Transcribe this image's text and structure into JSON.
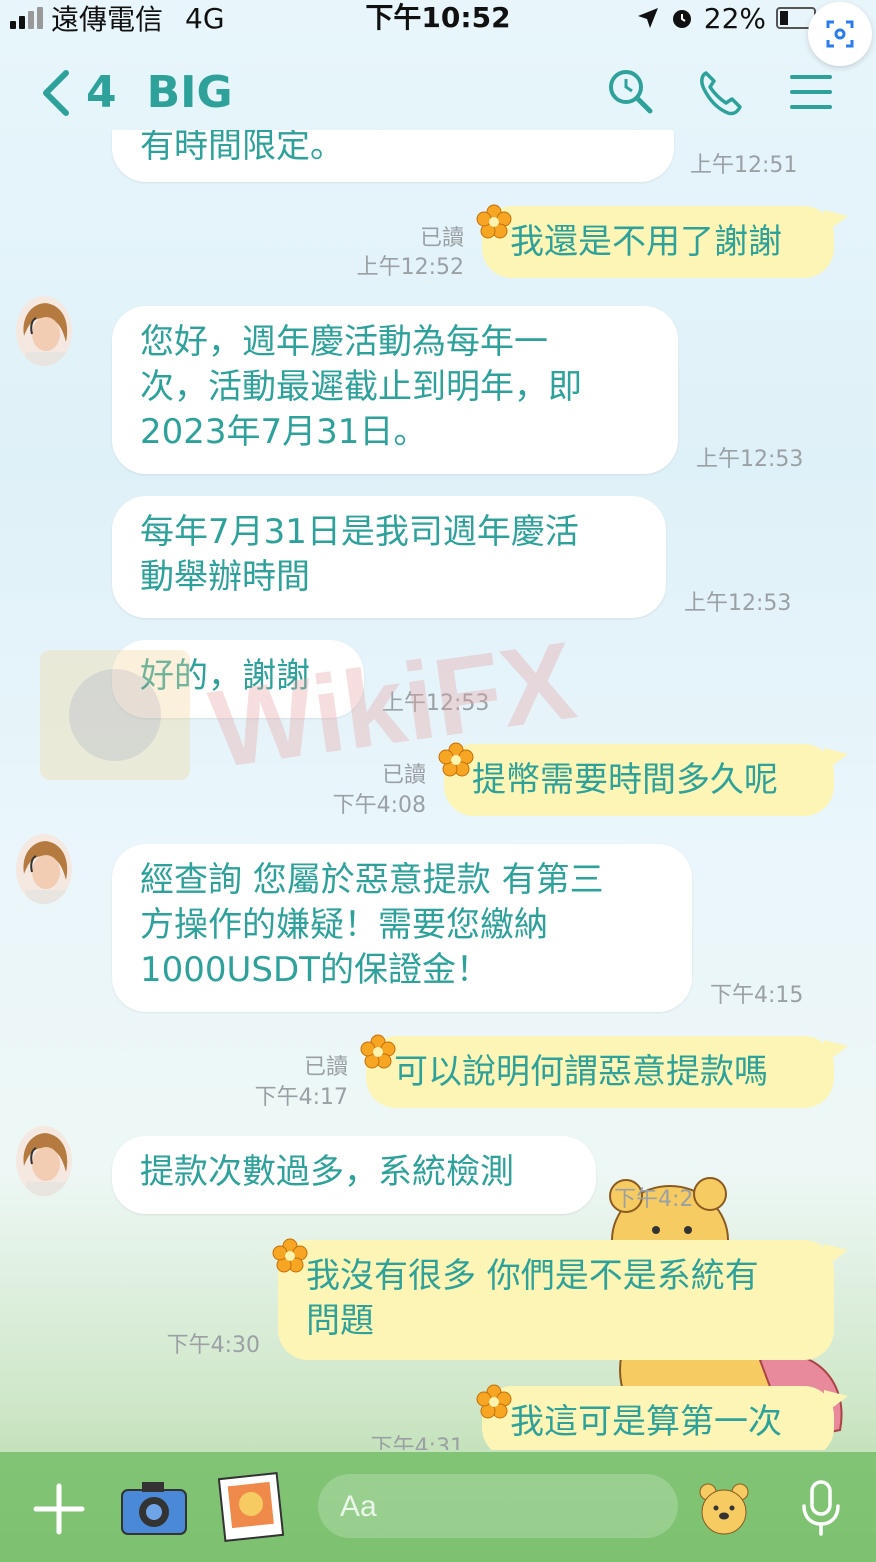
{
  "status": {
    "carrier": "遠傳電信",
    "network": "4G",
    "time": "下午10:52",
    "battery": "22%"
  },
  "header": {
    "back_count": "4",
    "title": "BIG",
    "icons": [
      "search-icon",
      "phone-icon",
      "menu-icon"
    ]
  },
  "messages": [
    {
      "side": "in",
      "text": "有時間限定。",
      "time": "上午12:51",
      "read": ""
    },
    {
      "side": "out",
      "text": "我還是不用了謝謝",
      "read": "已讀",
      "time": "上午12:52"
    },
    {
      "side": "in",
      "text": "您好，週年慶活動為每年一\n次，活動最遲截止到明年，即\n2023年7月31日。",
      "time": "上午12:53",
      "read": ""
    },
    {
      "side": "in",
      "text": "每年7月31日是我司週年慶活\n動舉辦時間",
      "time": "上午12:53",
      "read": ""
    },
    {
      "side": "in",
      "text": "好的，謝謝",
      "time": "上午12:53",
      "read": ""
    },
    {
      "side": "out",
      "text": "提幣需要時間多久呢",
      "read": "已讀",
      "time": "下午4:08"
    },
    {
      "side": "in",
      "text": "經查詢 您屬於惡意提款 有第三\n方操作的嫌疑！需要您繳納\n1000USDT的保證金！",
      "time": "下午4:15",
      "read": ""
    },
    {
      "side": "out",
      "text": "可以說明何謂惡意提款嗎",
      "read": "已讀",
      "time": "下午4:17"
    },
    {
      "side": "in",
      "text": "提款次數過多，系統檢測",
      "time": "下午4:2",
      "read": ""
    },
    {
      "side": "out",
      "text": "我沒有很多 你們是不是系統有\n問題",
      "read": "",
      "time": "下午4:30"
    },
    {
      "side": "out",
      "text": "我這可是算第一次",
      "read": "",
      "time": "下午4:31"
    }
  ],
  "watermark": "WikiFX",
  "input": {
    "placeholder": "Aa"
  },
  "colors": {
    "accent": "#2ea29a",
    "bubble_out": "#fcf5b6",
    "bubble_in": "#ffffff",
    "bottom_bar": "#76be68"
  }
}
